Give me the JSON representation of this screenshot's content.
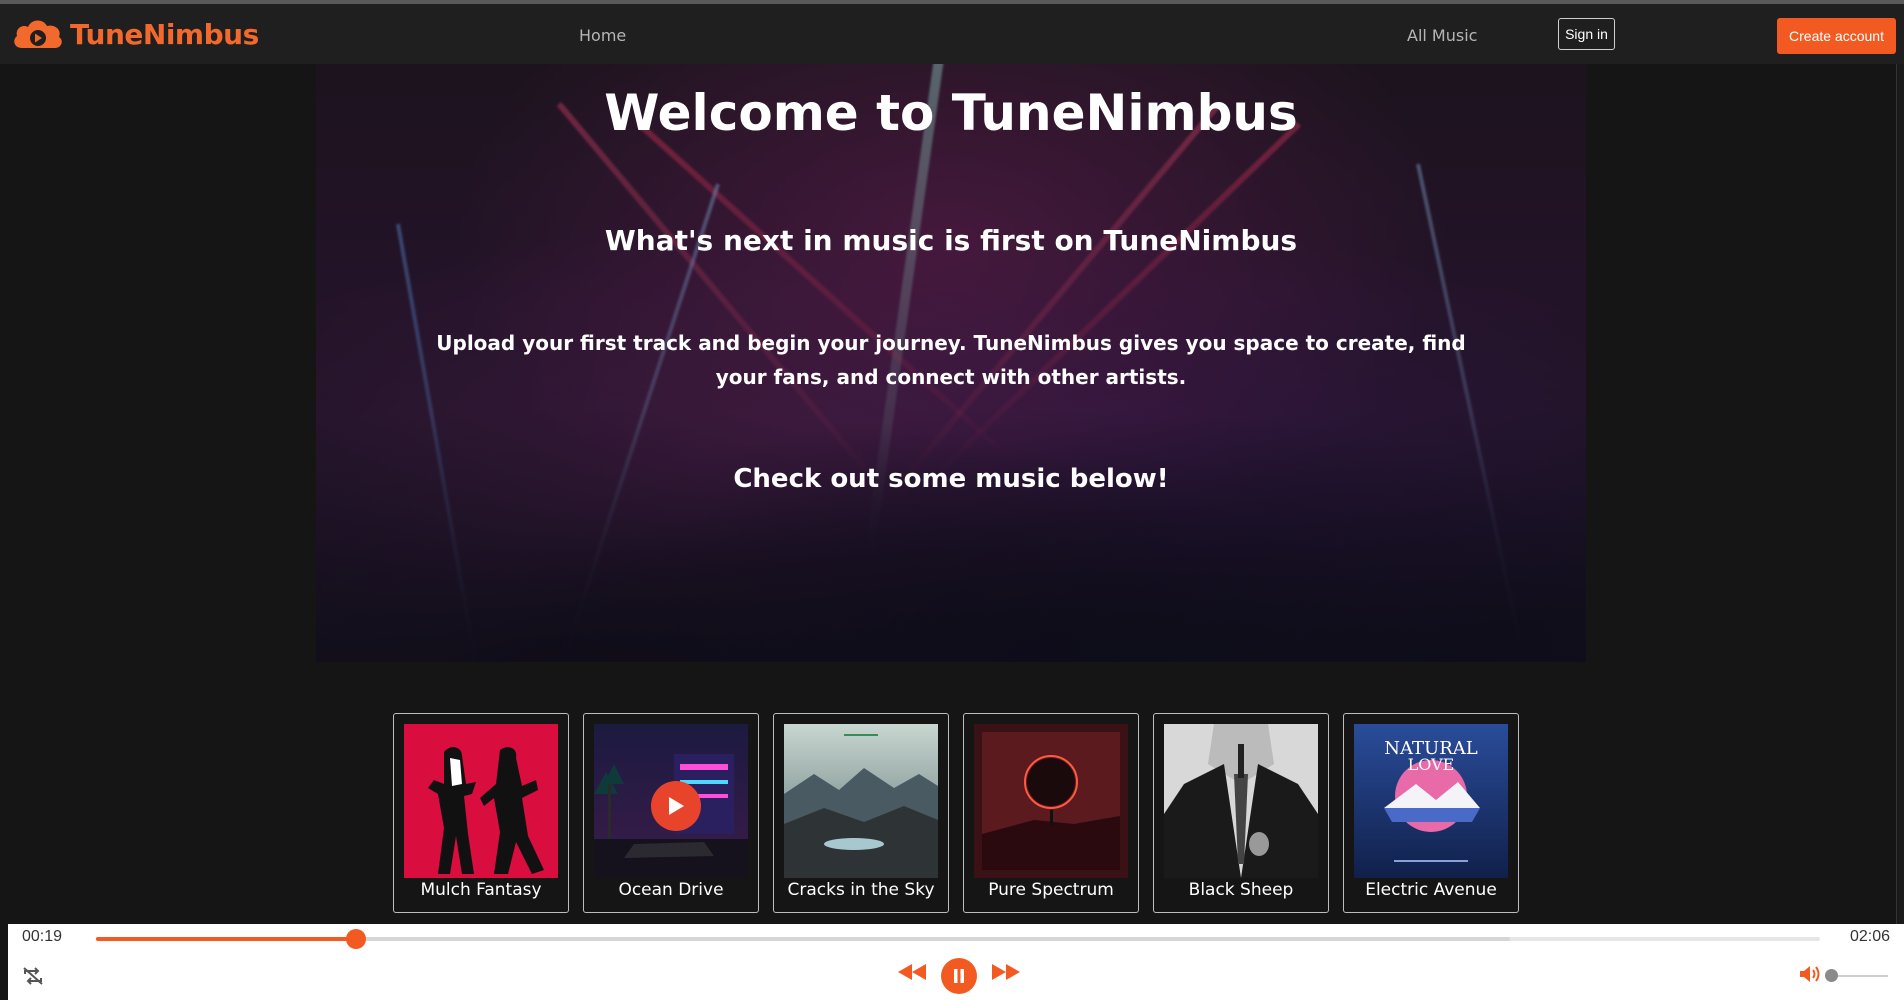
{
  "app": {
    "name": "TuneNimbus",
    "brand_color": "#f25a22"
  },
  "nav": {
    "home": "Home",
    "all_music": "All Music",
    "sign_in": "Sign in",
    "create_account": "Create account"
  },
  "hero": {
    "title": "Welcome to TuneNimbus",
    "subtitle": "What's next in music is first on TuneNimbus",
    "body": "Upload your first track and begin your journey. TuneNimbus gives you space to create, find your fans, and connect with other artists.",
    "cta": "Check out some music below!"
  },
  "tracks": [
    {
      "title": "Mulch Fantasy",
      "cover": "dancing-silhouettes"
    },
    {
      "title": "Ocean Drive",
      "cover": "neon-night-street",
      "playing": true
    },
    {
      "title": "Cracks in the Sky",
      "cover": "mountain-landscape"
    },
    {
      "title": "Pure Spectrum",
      "cover": "red-eclipse"
    },
    {
      "title": "Black Sheep",
      "cover": "man-in-suit"
    },
    {
      "title": "Electric Avenue",
      "cover": "natural-love"
    }
  ],
  "covers": {
    "electric_avenue_text_1": "NATURAL",
    "electric_avenue_text_2": "LOVE"
  },
  "player": {
    "current_time": "00:19",
    "duration": "02:06",
    "progress": 0.151,
    "volume": 0.0
  }
}
